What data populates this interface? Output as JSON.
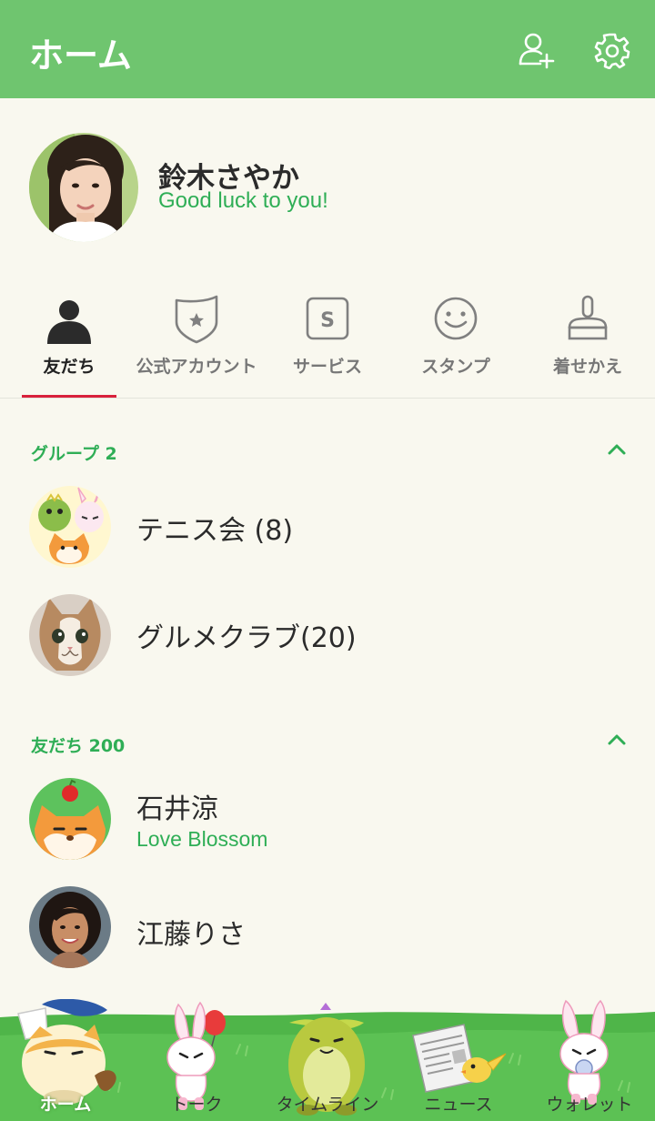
{
  "header": {
    "title": "ホーム",
    "add_friend_icon": "add-user-icon",
    "settings_icon": "gear-icon"
  },
  "profile": {
    "name": "鈴木さやか",
    "status": "Good luck to you!"
  },
  "tabs": [
    {
      "label": "友だち",
      "icon": "person-icon",
      "active": true
    },
    {
      "label": "公式アカウント",
      "icon": "shield-star-icon",
      "active": false
    },
    {
      "label": "サービス",
      "icon": "s-box-icon",
      "active": false
    },
    {
      "label": "スタンプ",
      "icon": "smiley-icon",
      "active": false
    },
    {
      "label": "着せかえ",
      "icon": "brush-icon",
      "active": false
    }
  ],
  "groups": {
    "header": "グループ 2",
    "items": [
      {
        "name": "テニス会 (8)"
      },
      {
        "name": "グルメクラブ(20)"
      }
    ]
  },
  "friends": {
    "header": "友だち 200",
    "items": [
      {
        "name": "石井涼",
        "status": "Love Blossom"
      },
      {
        "name": "江藤りさ",
        "status": ""
      }
    ]
  },
  "bottom_nav": [
    {
      "label": "ホーム",
      "active": true
    },
    {
      "label": "トーク",
      "active": false
    },
    {
      "label": "タイムライン",
      "active": false
    },
    {
      "label": "ニュース",
      "active": false
    },
    {
      "label": "ウォレット",
      "active": false
    }
  ],
  "colors": {
    "header_bg": "#6fc56f",
    "accent_green": "#2fae56",
    "active_tab_underline": "#d9213b",
    "background": "#f9f8ef"
  }
}
